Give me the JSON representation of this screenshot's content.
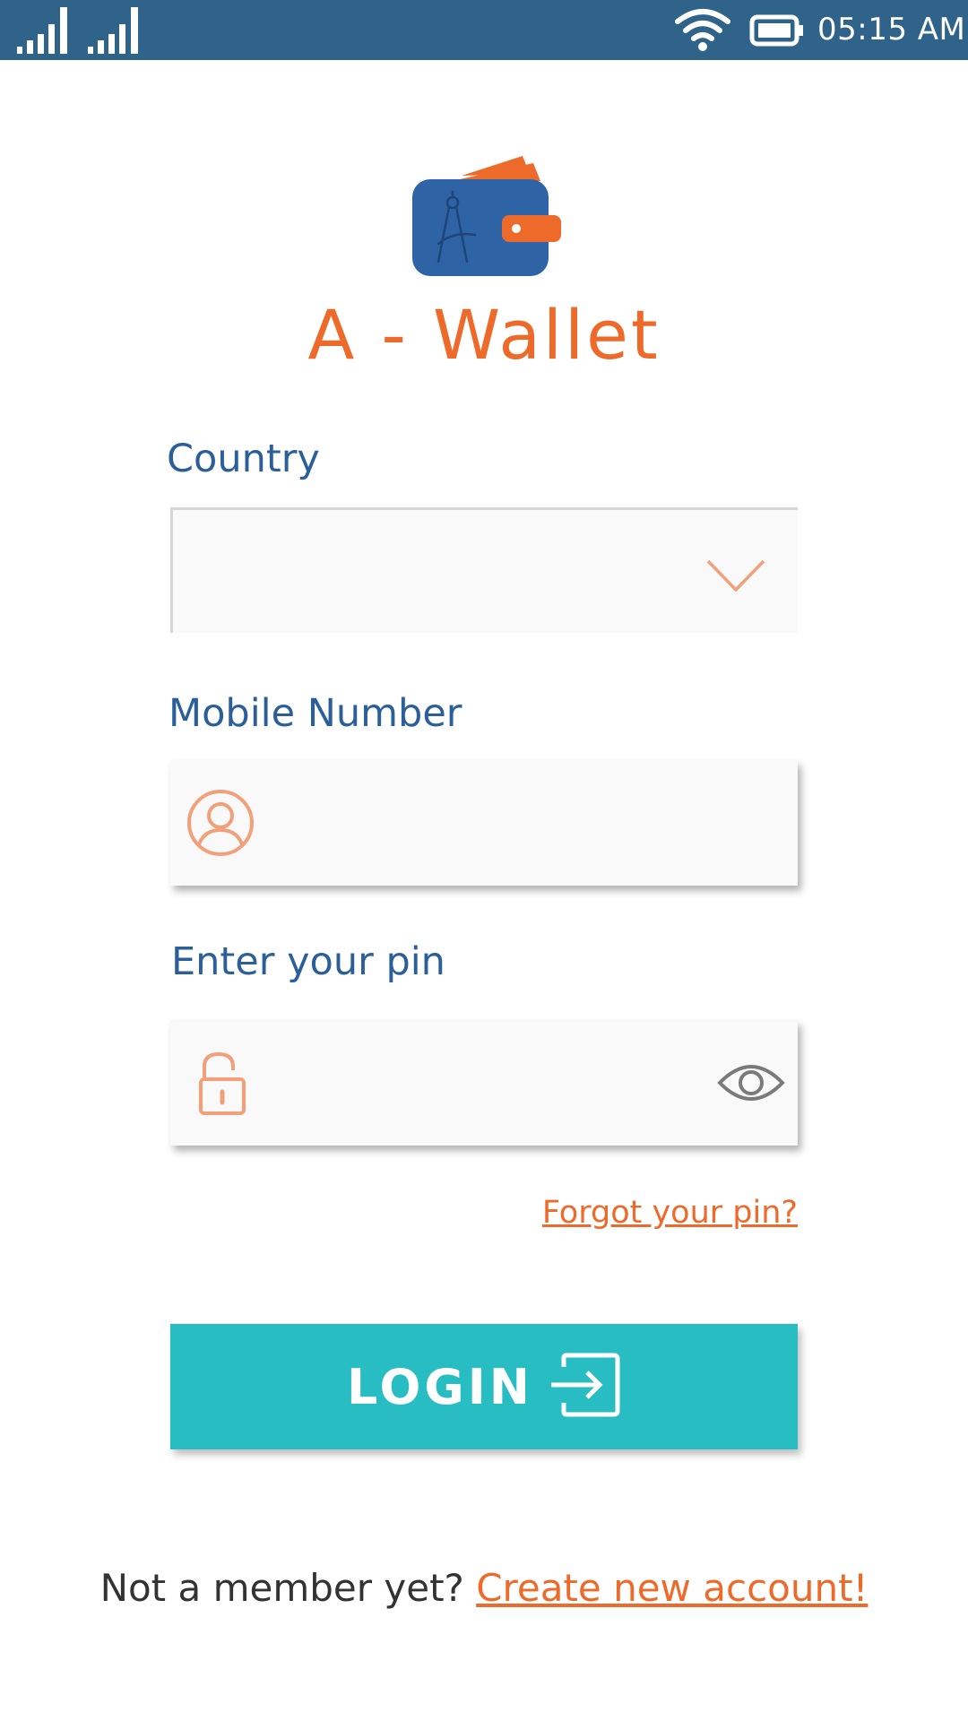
{
  "status_bar": {
    "time": "05:15 AM"
  },
  "app": {
    "title": "A - Wallet",
    "logo_icon": "wallet-icon"
  },
  "form": {
    "country_label": "Country",
    "country_value": "",
    "mobile_label": "Mobile Number",
    "mobile_value": "",
    "pin_label": "Enter your pin",
    "pin_value": "",
    "forgot_label": "Forgot your pin?",
    "login_label": "LOGIN"
  },
  "footer": {
    "prompt": "Not a member yet?",
    "link": "Create new account!"
  },
  "colors": {
    "status_bar": "#2f6389",
    "accent_orange": "#ee6a2b",
    "label_blue": "#2a5f99",
    "login_teal": "#27bdc2"
  }
}
